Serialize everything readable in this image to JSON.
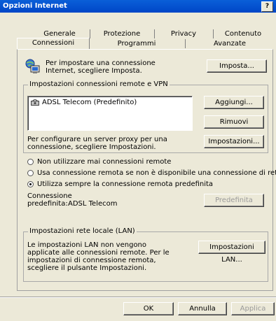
{
  "window": {
    "title": "Opzioni Internet",
    "help_label": "?"
  },
  "tabs_back": [
    "Generale",
    "Protezione",
    "Privacy",
    "Contenuto"
  ],
  "tabs_front": [
    "Connessioni",
    "Programmi",
    "Avanzate"
  ],
  "setup": {
    "text": "Per impostare una connessione Internet, scegliere Imposta.",
    "button": "Imposta..."
  },
  "remote_group": {
    "label": "Impostazioni connessioni remote e VPN",
    "items": [
      "ADSL Telecom (Predefinito)"
    ],
    "add_button": "Aggiungi...",
    "remove_button": "Rimuovi"
  },
  "proxy": {
    "text": "Per configurare un server proxy per una connessione, scegliere Impostazioni.",
    "button": "Impostazioni..."
  },
  "radios": [
    {
      "label": "Non utilizzare mai connessioni remote",
      "checked": false
    },
    {
      "label": "Usa connessione remota se non è disponibile una connessione di rete",
      "checked": false
    },
    {
      "label": "Utilizza sempre la connessione remota predefinita",
      "checked": true
    }
  ],
  "default_conn": {
    "label_line1": "Connessione",
    "label_line2": "predefinita:",
    "value": "ADSL Telecom",
    "button": "Predefinita"
  },
  "lan_group": {
    "label": "Impostazioni rete locale (LAN)",
    "text": "Le impostazioni LAN non vengono applicate alle connessioni remote. Per le impostazioni di connessione remota, scegliere il pulsante Impostazioni.",
    "button": "Impostazioni LAN..."
  },
  "footer": {
    "ok": "OK",
    "cancel": "Annulla",
    "apply": "Applica"
  }
}
